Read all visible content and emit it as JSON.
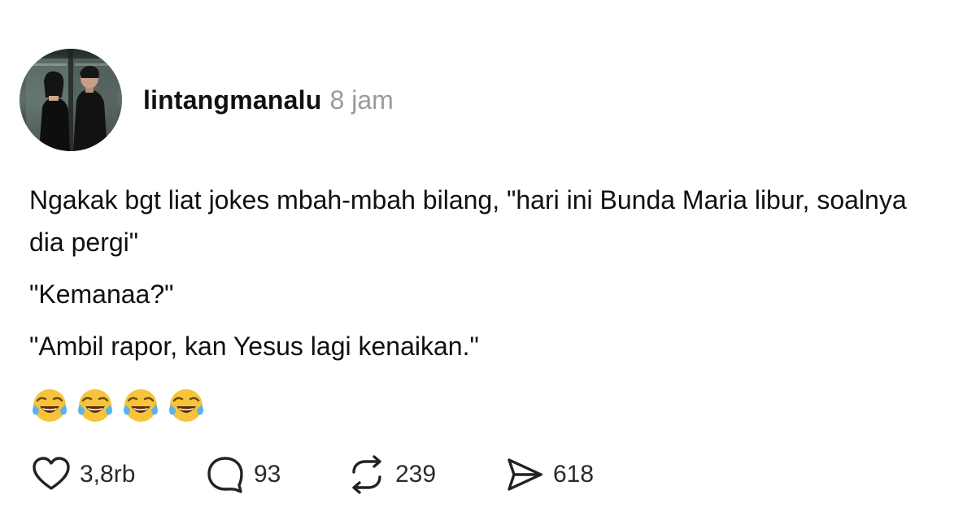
{
  "post": {
    "username": "lintangmanalu",
    "timestamp": "8 jam",
    "lines": [
      "Ngakak bgt liat jokes mbah-mbah bilang, \"hari ini Bunda Maria libur, soalnya dia pergi\"",
      "\"Kemanaa?\"",
      "\"Ambil rapor, kan Yesus lagi kenaikan.\""
    ],
    "emoji_count": 4,
    "emoji_name": "face-with-tears-of-joy"
  },
  "actions": {
    "like_count": "3,8rb",
    "reply_count": "93",
    "repost_count": "239",
    "share_count": "618"
  },
  "icons": {
    "like": "heart-icon",
    "reply": "speech-bubble-icon",
    "repost": "repost-arrows-icon",
    "share": "paper-plane-icon"
  },
  "colors": {
    "text": "#101010",
    "muted": "#9a9a9a",
    "icon": "#222222",
    "background": "#ffffff"
  }
}
